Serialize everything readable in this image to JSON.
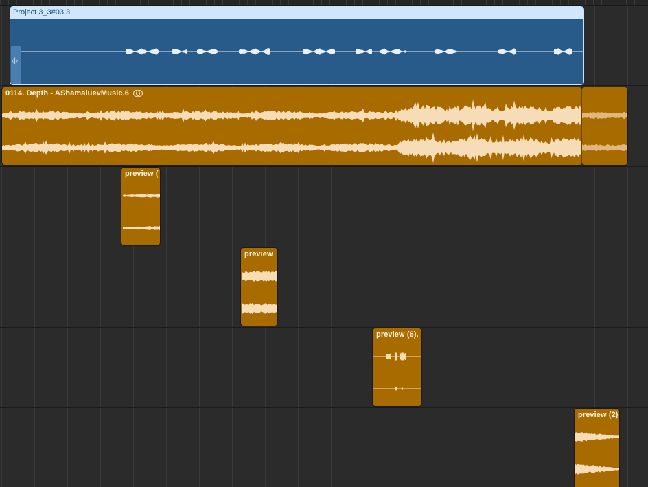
{
  "arrange": {
    "project_region": {
      "label": "Project 3_3#03.3",
      "handle_glyph": "‹|›"
    },
    "main_region": {
      "label": "0114. Depth - AShamaluevMusic.6",
      "loop_icon": "ring-icon"
    },
    "preview_regions": [
      {
        "label": "preview ("
      },
      {
        "label": "preview"
      },
      {
        "label": "preview (6)."
      },
      {
        "label": "preview (2)"
      }
    ]
  },
  "colors": {
    "audio_region": "#a86b00",
    "audio_waveform": "#f7dcb8",
    "project_region": "#285a8a",
    "project_header": "#cfe6fb",
    "background": "#2b2b2b"
  }
}
